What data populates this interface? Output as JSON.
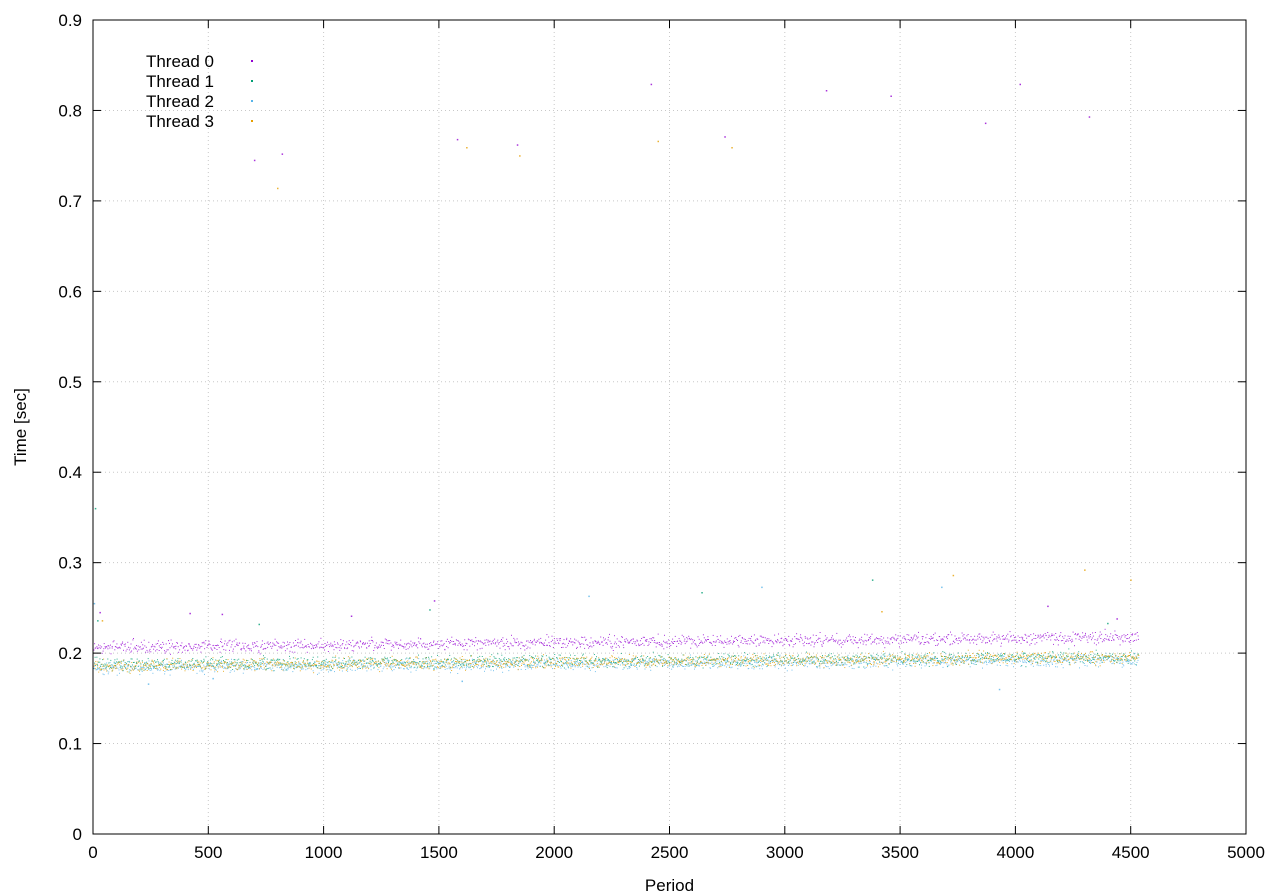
{
  "chart_data": {
    "type": "scatter",
    "xlabel": "Period",
    "ylabel": "Time [sec]",
    "xlim": [
      0,
      5000
    ],
    "ylim": [
      0,
      0.9
    ],
    "xticks": [
      0,
      500,
      1000,
      1500,
      2000,
      2500,
      3000,
      3500,
      4000,
      4500,
      5000
    ],
    "yticks": [
      0,
      0.1,
      0.2,
      0.3,
      0.4,
      0.5,
      0.6,
      0.7,
      0.8,
      0.9
    ],
    "ytick_labels": [
      "0",
      "0.1",
      "0.2",
      "0.3",
      "0.4",
      "0.5",
      "0.6",
      "0.7",
      "0.8",
      "0.9"
    ],
    "grid": true,
    "legend_position": "top-left",
    "x_count": 4530,
    "series": [
      {
        "name": "Thread 0",
        "color": "#9400d3",
        "baseline_start": 0.207,
        "baseline_end": 0.218,
        "spread": 0.006,
        "outliers": [
          [
            30,
            0.245
          ],
          [
            420,
            0.244
          ],
          [
            560,
            0.243
          ],
          [
            700,
            0.745
          ],
          [
            820,
            0.752
          ],
          [
            1120,
            0.241
          ],
          [
            1480,
            0.258
          ],
          [
            1580,
            0.768
          ],
          [
            1840,
            0.762
          ],
          [
            2420,
            0.829
          ],
          [
            2740,
            0.771
          ],
          [
            3180,
            0.822
          ],
          [
            3460,
            0.816
          ],
          [
            3870,
            0.786
          ],
          [
            4020,
            0.829
          ],
          [
            4140,
            0.252
          ],
          [
            4320,
            0.793
          ],
          [
            4440,
            0.238
          ]
        ]
      },
      {
        "name": "Thread 1",
        "color": "#009e73",
        "baseline_start": 0.188,
        "baseline_end": 0.196,
        "spread": 0.006,
        "outliers": [
          [
            10,
            0.36
          ],
          [
            20,
            0.236
          ],
          [
            720,
            0.232
          ],
          [
            1460,
            0.248
          ],
          [
            2640,
            0.267
          ],
          [
            3380,
            0.281
          ],
          [
            4400,
            0.233
          ]
        ]
      },
      {
        "name": "Thread 2",
        "color": "#56b4e9",
        "baseline_start": 0.184,
        "baseline_end": 0.193,
        "spread": 0.006,
        "outliers": [
          [
            5,
            0.255
          ],
          [
            240,
            0.166
          ],
          [
            520,
            0.172
          ],
          [
            1600,
            0.169
          ],
          [
            2150,
            0.263
          ],
          [
            2900,
            0.273
          ],
          [
            3680,
            0.273
          ],
          [
            3930,
            0.16
          ]
        ]
      },
      {
        "name": "Thread 3",
        "color": "#e69f00",
        "baseline_start": 0.186,
        "baseline_end": 0.196,
        "spread": 0.006,
        "outliers": [
          [
            40,
            0.236
          ],
          [
            800,
            0.714
          ],
          [
            1620,
            0.759
          ],
          [
            1850,
            0.75
          ],
          [
            2450,
            0.766
          ],
          [
            2770,
            0.759
          ],
          [
            3420,
            0.246
          ],
          [
            3730,
            0.286
          ],
          [
            4300,
            0.292
          ],
          [
            4500,
            0.281
          ]
        ]
      }
    ]
  }
}
